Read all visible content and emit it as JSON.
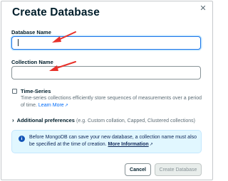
{
  "dialog": {
    "title": "Create Database",
    "close_glyph": "✕"
  },
  "fields": {
    "database_name": {
      "label": "Database Name",
      "value": ""
    },
    "collection_name": {
      "label": "Collection Name",
      "value": ""
    }
  },
  "time_series": {
    "checked": false,
    "label": "Time-Series",
    "description": "Time-series collections efficiently store sequences of measurements over a period of time.",
    "learn_more": "Learn More"
  },
  "additional_preferences": {
    "label": "Additional preferences",
    "hint": "(e.g. Custom collation, Capped, Clustered collections)"
  },
  "info_banner": {
    "icon": "info-icon",
    "text": "Before MongoDB can save your new database, a collection name must also be specified at the time of creation.",
    "more": "More Information"
  },
  "buttons": {
    "cancel": "Cancel",
    "create": "Create Database"
  },
  "colors": {
    "focus_border": "#1a73e8",
    "annotation_arrow": "#e8312a",
    "link": "#016bf8",
    "info_bg": "#e1f7ff"
  }
}
